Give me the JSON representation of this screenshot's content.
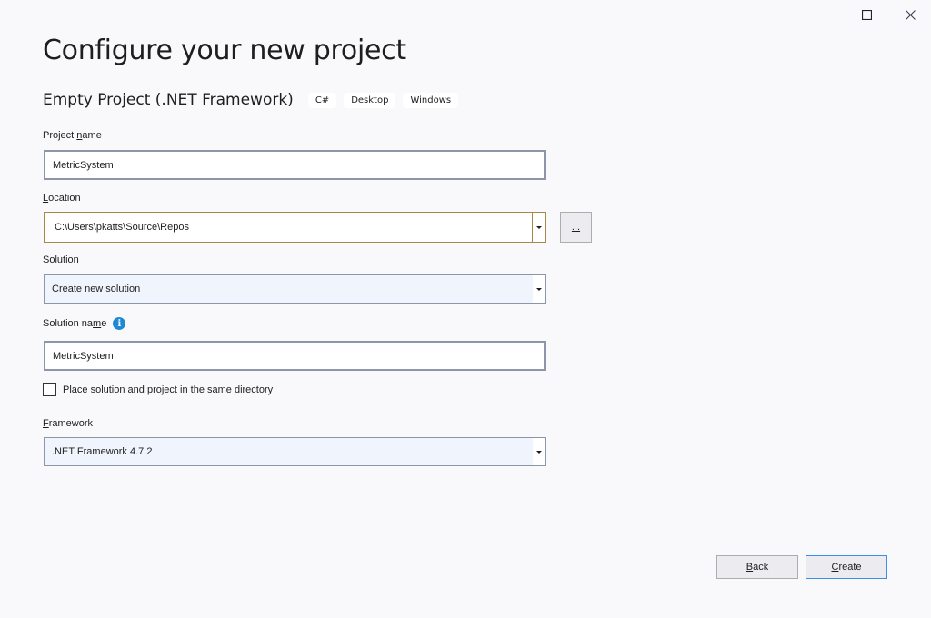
{
  "window": {
    "maximize_icon": "maximize-icon",
    "close_icon": "close-icon"
  },
  "header": {
    "title": "Configure your new project",
    "template_name": "Empty Project (.NET Framework)",
    "tags": [
      "C#",
      "Desktop",
      "Windows"
    ]
  },
  "form": {
    "project_name": {
      "label_pre": "Project ",
      "label_accel": "n",
      "label_post": "ame",
      "value": "MetricSystem"
    },
    "location": {
      "label_accel": "L",
      "label_post": "ocation",
      "value": "C:\\Users\\pkatts\\Source\\Repos",
      "browse_label": "..."
    },
    "solution": {
      "label_accel": "S",
      "label_post": "olution",
      "value": "Create new solution"
    },
    "solution_name": {
      "label_pre": "Solution na",
      "label_accel": "m",
      "label_post": "e",
      "value": "MetricSystem",
      "info_icon": "info-icon"
    },
    "same_directory": {
      "label_pre": "Place solution and project in the same ",
      "label_accel": "d",
      "label_post": "irectory",
      "checked": false
    },
    "framework": {
      "label_accel": "F",
      "label_post": "ramework",
      "value": ".NET Framework 4.7.2"
    }
  },
  "footer": {
    "back_accel": "B",
    "back_rest": "ack",
    "create_accel": "C",
    "create_rest": "reate"
  }
}
